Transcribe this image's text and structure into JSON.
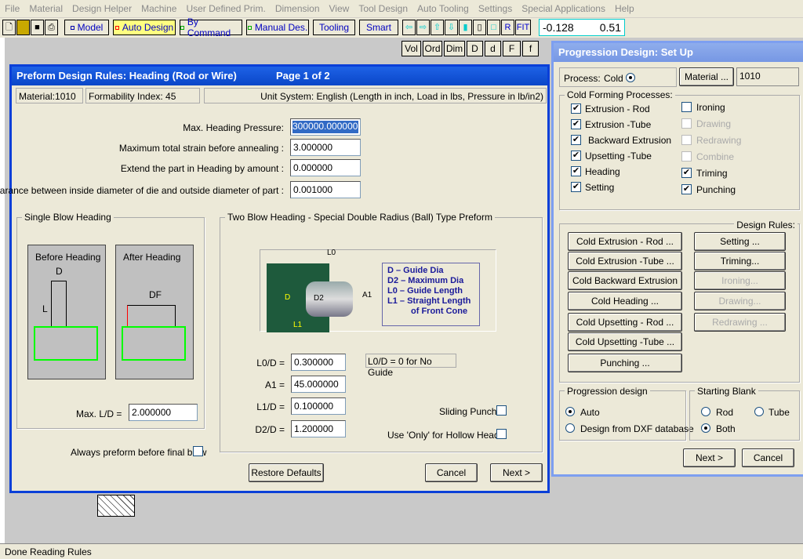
{
  "menu": [
    "File",
    "Material",
    "Design Helper",
    "Machine",
    "User Defined Prim.",
    "Dimension",
    "View",
    "Tool Design",
    "Auto Tooling",
    "Settings",
    "Special Applications",
    "Help"
  ],
  "toolbar": {
    "model": "Model",
    "auto_design": "Auto Design",
    "by_command": "By Command",
    "manual_des": "Manual Des.",
    "tooling": "Tooling",
    "smart": "Smart",
    "r": "R",
    "fit": "FIT",
    "coord_x": "-0.128",
    "coord_y": "0.51"
  },
  "toolbar2": [
    "Vol",
    "Ord",
    "Dim",
    "D",
    "d",
    "F",
    "f"
  ],
  "status": "Done Reading Rules",
  "preform": {
    "title": "Preform Design Rules: Heading  (Rod or Wire)",
    "page": "Page 1 of 2",
    "material": "Material:1010",
    "formability": "Formability Index: 45",
    "units": "Unit System: English (Length in inch, Load in lbs, Pressure in lb/in2)",
    "fields": [
      {
        "label": "Max. Heading Pressure:",
        "value": "300000.000000"
      },
      {
        "label": "Maximum total strain before annealing :",
        "value": "3.000000"
      },
      {
        "label": "Extend the part in Heading by amount :",
        "value": "0.000000"
      },
      {
        "label": "Clearance between inside diameter of die and outside diameter of part :",
        "value": "0.001000"
      }
    ],
    "single": {
      "title": "Single Blow Heading",
      "before": "Before Heading",
      "after": "After Heading",
      "d": "D",
      "l": "L",
      "df": "DF",
      "maxld_label": "Max. L/D =",
      "maxld": "2.000000"
    },
    "always_preform": "Always preform before final blow",
    "two": {
      "title": "Two Blow Heading - Special Double Radius (Ball) Type Preform",
      "legend": [
        "D    – Guide Dia",
        "D2  – Maximum Dia",
        "L0   – Guide Length",
        "L1   – Straight Length",
        "of Front Cone"
      ],
      "diag": {
        "l0": "L0",
        "d": "D",
        "d2": "D2",
        "a1": "A1",
        "l1": "L1"
      },
      "fields": [
        {
          "label": "L0/D =",
          "value": "0.300000"
        },
        {
          "label": "A1 =",
          "value": "45.000000"
        },
        {
          "label": "L1/D =",
          "value": "0.100000"
        },
        {
          "label": "D2/D =",
          "value": "1.200000"
        }
      ],
      "note": "L0/D = 0 for No Guide",
      "sliding": "Sliding Punch",
      "hollow": "Use 'Only' for Hollow Heads"
    },
    "restore": "Restore Defaults",
    "cancel": "Cancel",
    "next": "Next >"
  },
  "progression": {
    "title": "Progression Design: Set Up",
    "process_label": "Process:",
    "process": "Cold",
    "material_btn": "Material ...",
    "material": "1010",
    "cf_title": "Cold Forming Processes:",
    "left": [
      {
        "label": "Extrusion - Rod",
        "checked": true
      },
      {
        "label": "Extrusion -Tube",
        "checked": true
      },
      {
        "label": "Backward Extrusion",
        "checked": true
      },
      {
        "label": "Upsetting -Tube",
        "checked": true
      },
      {
        "label": "Heading",
        "checked": true
      },
      {
        "label": "Setting",
        "checked": true
      }
    ],
    "right": [
      {
        "label": "Ironing",
        "checked": false,
        "disabled": false
      },
      {
        "label": "Drawing",
        "checked": false,
        "disabled": true
      },
      {
        "label": "Redrawing",
        "checked": false,
        "disabled": true
      },
      {
        "label": "Combine",
        "checked": false,
        "disabled": true
      },
      {
        "label": "Triming",
        "checked": true,
        "disabled": false
      },
      {
        "label": "Punching",
        "checked": true,
        "disabled": false
      }
    ],
    "rules_title": "Design Rules:",
    "rules_left": [
      "Cold Extrusion - Rod ...",
      "Cold Extrusion -Tube ...",
      "Cold Backward Extrusion ...",
      "Cold Heading ...",
      "Cold Upsetting - Rod ...",
      "Cold Upsetting -Tube ...",
      "Punching ..."
    ],
    "rules_right": [
      {
        "label": "Setting ...",
        "disabled": false
      },
      {
        "label": "Triming...",
        "disabled": false
      },
      {
        "label": "Ironing...",
        "disabled": true
      },
      {
        "label": "Drawing...",
        "disabled": true
      },
      {
        "label": "Redrawing ...",
        "disabled": true
      }
    ],
    "pd_title": "Progression design",
    "pd_auto": "Auto",
    "pd_dxf": "Design from DXF database",
    "sb_title": "Starting Blank",
    "sb_rod": "Rod",
    "sb_tube": "Tube",
    "sb_both": "Both",
    "next": "Next >",
    "cancel": "Cancel"
  }
}
